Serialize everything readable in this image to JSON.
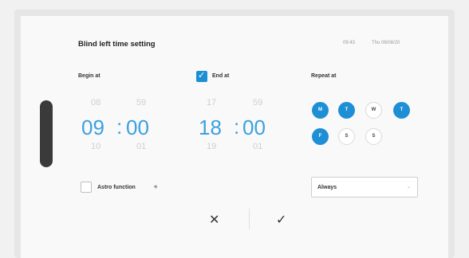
{
  "header": {
    "title": "Blind left time setting",
    "clock": "09:43",
    "date": "Thu 06/08/20"
  },
  "begin": {
    "label": "Begin at",
    "hour_prev": "08",
    "hour": "09",
    "hour_next": "10",
    "min_prev": "59",
    "min": "00",
    "min_next": "01",
    "colon": ":"
  },
  "end": {
    "label": "End at",
    "enabled": true,
    "hour_prev": "17",
    "hour": "18",
    "hour_next": "19",
    "min_prev": "59",
    "min": "00",
    "min_next": "01",
    "colon": ":"
  },
  "repeat": {
    "label": "Repeat at",
    "days": [
      {
        "label": "M",
        "active": true
      },
      {
        "label": "T",
        "active": true
      },
      {
        "label": "W",
        "active": false
      },
      {
        "label": "T",
        "active": true
      },
      {
        "label": "F",
        "active": true
      },
      {
        "label": "S",
        "active": false
      },
      {
        "label": "S",
        "active": false
      }
    ],
    "mode": "Always"
  },
  "astro": {
    "label": "Astro function",
    "enabled": false
  },
  "actions": {
    "cancel": "✕",
    "confirm": "✓"
  },
  "colors": {
    "accent": "#1e8fd5",
    "time_text": "#3ba0df"
  }
}
